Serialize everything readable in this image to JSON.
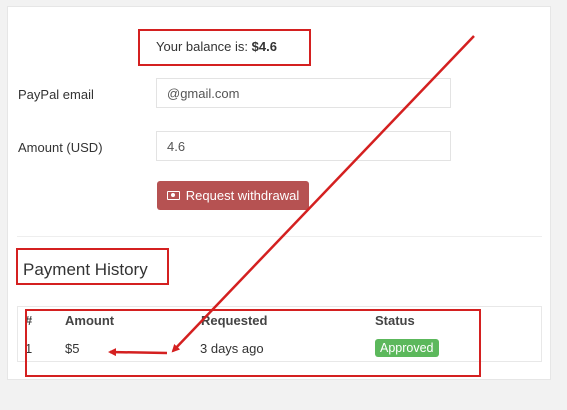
{
  "balance": {
    "label": "Your balance is:",
    "value": "$4.6"
  },
  "form": {
    "paypal_label": "PayPal email",
    "paypal_value": "@gmail.com",
    "amount_label": "Amount (USD)",
    "amount_value": "4.6",
    "submit_label": "Request withdrawal"
  },
  "history": {
    "title": "Payment History",
    "columns": [
      "#",
      "Amount",
      "Requested",
      "Status"
    ],
    "rows": [
      {
        "num": "1",
        "amount": "$5",
        "requested": "3 days ago",
        "status": "Approved"
      }
    ]
  },
  "colors": {
    "withdraw_button": "#b65252",
    "approved_badge": "#5cb85c",
    "annotation": "#d42020"
  },
  "icons": {
    "withdraw_button_icon": "money-icon"
  }
}
